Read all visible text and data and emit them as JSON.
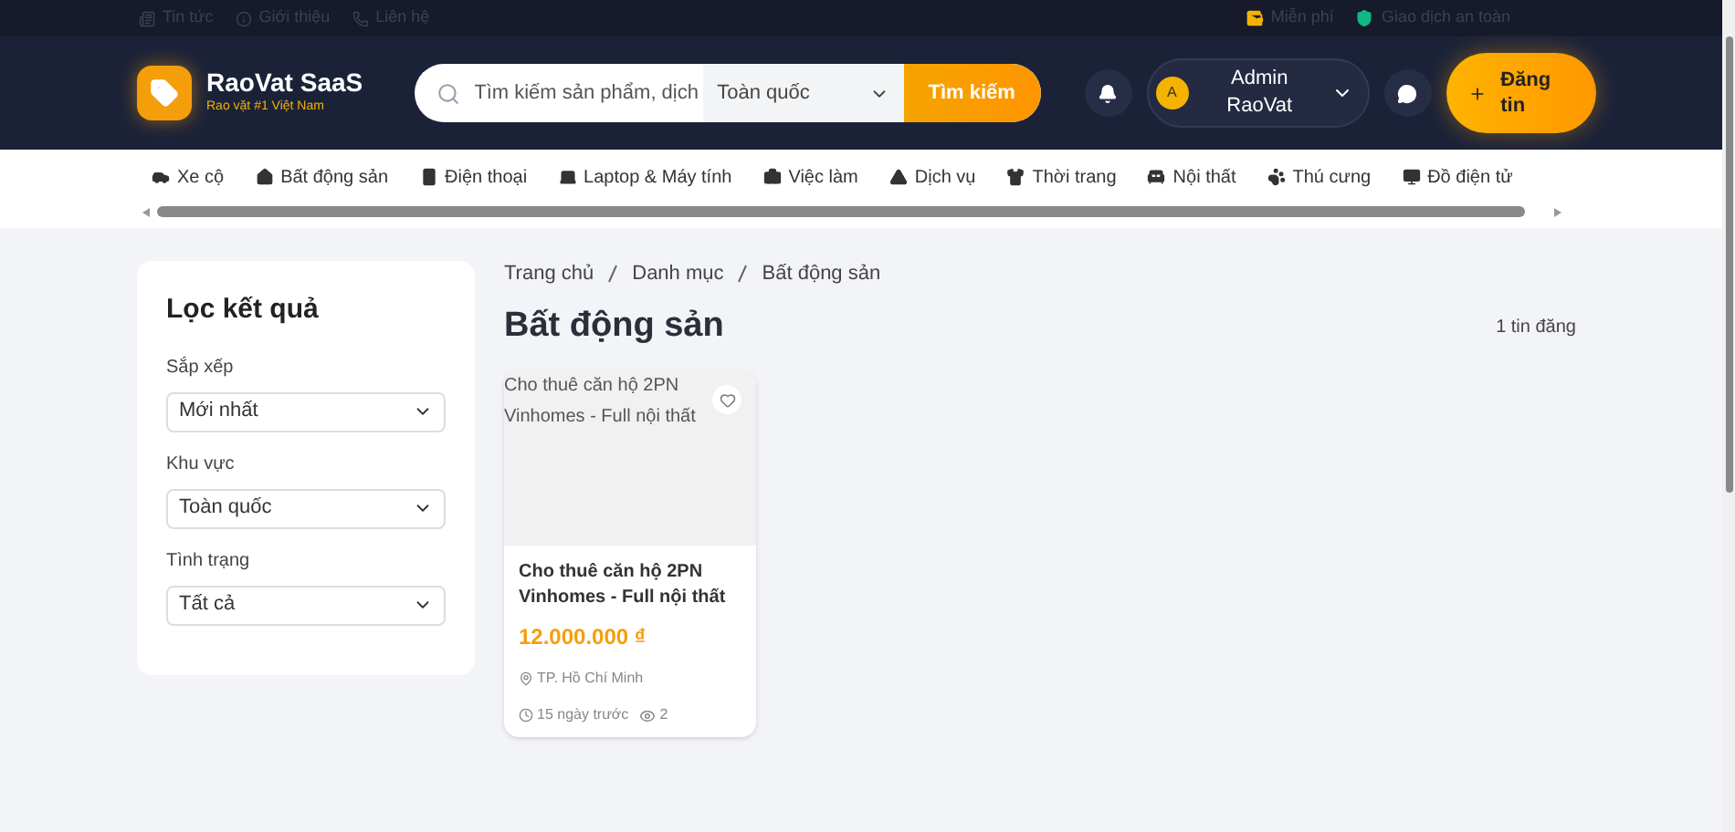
{
  "topbar": {
    "left": [
      {
        "kind": "news",
        "label": "Tin tức"
      },
      {
        "kind": "info",
        "label": "Giới thiệu"
      },
      {
        "kind": "phone",
        "label": "Liên hệ"
      }
    ],
    "right": [
      {
        "kind": "wallet",
        "label": "Miễn phí"
      },
      {
        "kind": "shield",
        "label": "Giao dịch an toàn"
      }
    ]
  },
  "header": {
    "brand": "RaoVat SaaS",
    "tagline": "Rao vặt #1 Việt Nam",
    "search": {
      "placeholder": "Tìm kiếm sản phẩm, dịch"
    },
    "region": "Toàn quốc",
    "search_button": "Tìm kiếm",
    "user": {
      "initial": "A",
      "name": "Admin RaoVat"
    },
    "post_button": "Đăng tin"
  },
  "categories": [
    {
      "kind": "car",
      "label": "Xe cộ",
      "selected": false
    },
    {
      "kind": "house",
      "label": "Bất động sản",
      "selected": false
    },
    {
      "kind": "phone",
      "label": "Điện thoại",
      "selected": false
    },
    {
      "kind": "laptop",
      "label": "Laptop & Máy tính",
      "selected": false
    },
    {
      "kind": "briefcase",
      "label": "Việc làm",
      "selected": false
    },
    {
      "kind": "service",
      "label": "Dịch vụ",
      "selected": false
    },
    {
      "kind": "shirt",
      "label": "Thời trang",
      "selected": false
    },
    {
      "kind": "sofa",
      "label": "Nội thất",
      "selected": false
    },
    {
      "kind": "paw",
      "label": "Thú cưng",
      "selected": false
    },
    {
      "kind": "monitor",
      "label": "Đồ điện tử",
      "selected": false
    }
  ],
  "filters": {
    "title": "Lọc kết quả",
    "fields": [
      {
        "label": "Sắp xếp",
        "value": "Mới nhất"
      },
      {
        "label": "Khu vực",
        "value": "Toàn quốc"
      },
      {
        "label": "Tình trạng",
        "value": "Tất cả"
      }
    ]
  },
  "breadcrumb": [
    "Trang chủ",
    "Danh mục",
    "Bất động sản"
  ],
  "page_title": "Bất động sản",
  "count": "1 tin đăng",
  "listings": [
    {
      "image_alt": "Cho thuê căn hộ 2PN Vinhomes - Full nội thất",
      "title": "Cho thuê căn hộ 2PN Vinhomes - Full nội thất",
      "price": "12.000.000 ₫",
      "location": "TP. Hồ Chí Minh",
      "time": "15 ngày trước",
      "views": "2",
      "favorite": false
    }
  ]
}
